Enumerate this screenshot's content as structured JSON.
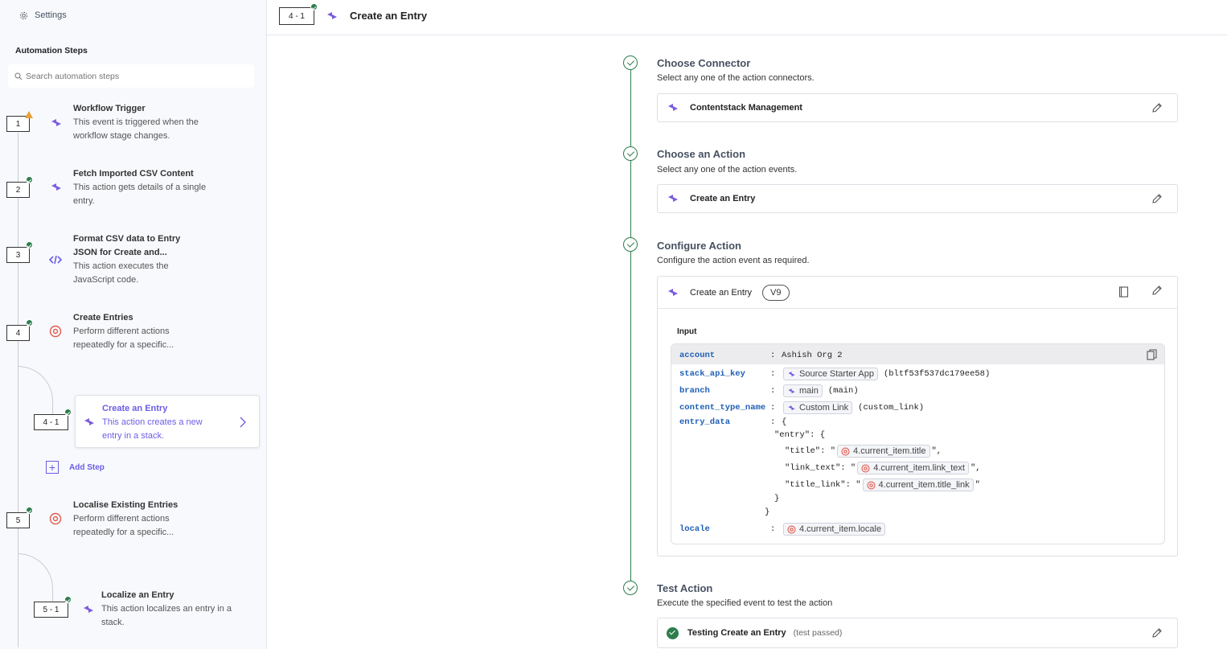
{
  "settings": {
    "label": "Settings"
  },
  "sidebar": {
    "title": "Automation Steps",
    "search_placeholder": "Search automation steps",
    "steps": [
      {
        "num": "1",
        "title": "Workflow Trigger",
        "desc": "This event is triggered when the workflow stage changes.",
        "status": "warning"
      },
      {
        "num": "2",
        "title": "Fetch Imported CSV Content",
        "desc": "This action gets details of a single entry.",
        "status": "ok"
      },
      {
        "num": "3",
        "title": "Format CSV data to Entry JSON for Create and...",
        "desc": "This action executes the JavaScript code.",
        "status": "ok"
      },
      {
        "num": "4",
        "title": "Create Entries",
        "desc": "Perform different actions repeatedly for a specific...",
        "status": "ok"
      },
      {
        "num": "4 - 1",
        "title": "Create an Entry",
        "desc": "This action creates a new entry in a stack.",
        "status": "ok"
      },
      {
        "num": "5",
        "title": "Localise Existing Entries",
        "desc": "Perform different actions repeatedly for a specific...",
        "status": "ok"
      },
      {
        "num": "5 - 1",
        "title": "Localize an Entry",
        "desc": "This action localizes an entry in a stack.",
        "status": "ok"
      }
    ],
    "add_step": "Add Step"
  },
  "header": {
    "num": "4 - 1",
    "title": "Create an Entry"
  },
  "sections": {
    "connector": {
      "title": "Choose Connector",
      "desc": "Select any one of the action connectors.",
      "value": "Contentstack Management"
    },
    "action": {
      "title": "Choose an Action",
      "desc": "Select any one of the action events.",
      "value": "Create an Entry"
    },
    "configure": {
      "title": "Configure Action",
      "desc": "Configure the action event as required.",
      "value": "Create an Entry",
      "version": "V9",
      "input_label": "Input",
      "rows": {
        "account": {
          "key": "account",
          "value": "Ashish Org 2"
        },
        "stack": {
          "key": "stack_api_key",
          "pill": "Source Starter App",
          "extra": "(bltf53f537dc179ee58)"
        },
        "branch": {
          "key": "branch",
          "pill": "main",
          "extra": "(main)"
        },
        "content_type": {
          "key": "content_type_name",
          "pill": "Custom Link",
          "extra": "(custom_link)"
        },
        "entry_data": {
          "key": "entry_data",
          "open": "{"
        },
        "entry_open": "\"entry\": {",
        "title": {
          "prefix": "\"title\": \"",
          "pill": "4.current_item.title",
          "suffix": "\","
        },
        "link_text": {
          "prefix": "\"link_text\": \"",
          "pill": "4.current_item.link_text",
          "suffix": "\","
        },
        "title_link": {
          "prefix": "\"title_link\": \"",
          "pill": "4.current_item.title_link",
          "suffix": "\""
        },
        "close_inner": "}",
        "close_outer": "}",
        "locale": {
          "key": "locale",
          "pill": "4.current_item.locale"
        }
      }
    },
    "test": {
      "title": "Test Action",
      "desc": "Execute the specified event to test the action",
      "value": "Testing Create an Entry",
      "status": "(test passed)"
    }
  },
  "colors": {
    "accent": "#6c5ce7",
    "success": "#2d7d4d",
    "warning": "#e8a23a",
    "loop": "#e05a4f"
  }
}
